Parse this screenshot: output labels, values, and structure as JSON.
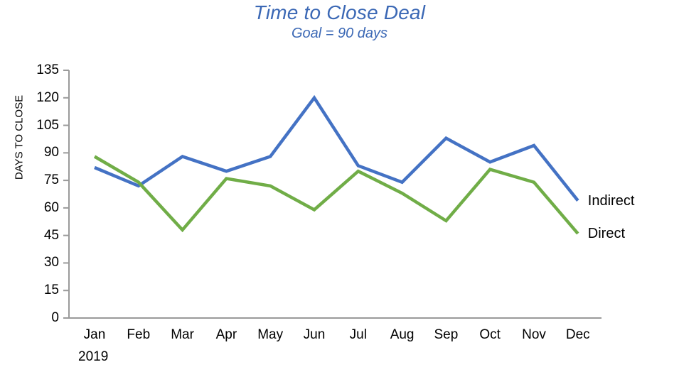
{
  "chart_data": {
    "type": "line",
    "title": "Time to Close Deal",
    "subtitle": "Goal = 90 days",
    "xlabel": "",
    "ylabel": "DAYS TO CLOSE",
    "year_label": "2019",
    "categories": [
      "Jan",
      "Feb",
      "Mar",
      "Apr",
      "May",
      "Jun",
      "Jul",
      "Aug",
      "Sep",
      "Oct",
      "Nov",
      "Dec"
    ],
    "ylim": [
      0,
      135
    ],
    "yticks": [
      135,
      120,
      105,
      90,
      75,
      60,
      45,
      30,
      15,
      0
    ],
    "grid": false,
    "legend_position": "right-end-labels",
    "series": [
      {
        "name": "Indirect",
        "color": "#4472C4",
        "values": [
          82,
          72,
          88,
          80,
          88,
          120,
          83,
          74,
          98,
          85,
          94,
          64
        ]
      },
      {
        "name": "Direct",
        "color": "#70AD47",
        "values": [
          88,
          74,
          48,
          76,
          72,
          59,
          80,
          68,
          53,
          81,
          74,
          46
        ]
      }
    ],
    "colors": {
      "title": "#3B68B5",
      "axis": "#9A9A9A",
      "indirect": "#4472C4",
      "direct": "#70AD47"
    }
  }
}
